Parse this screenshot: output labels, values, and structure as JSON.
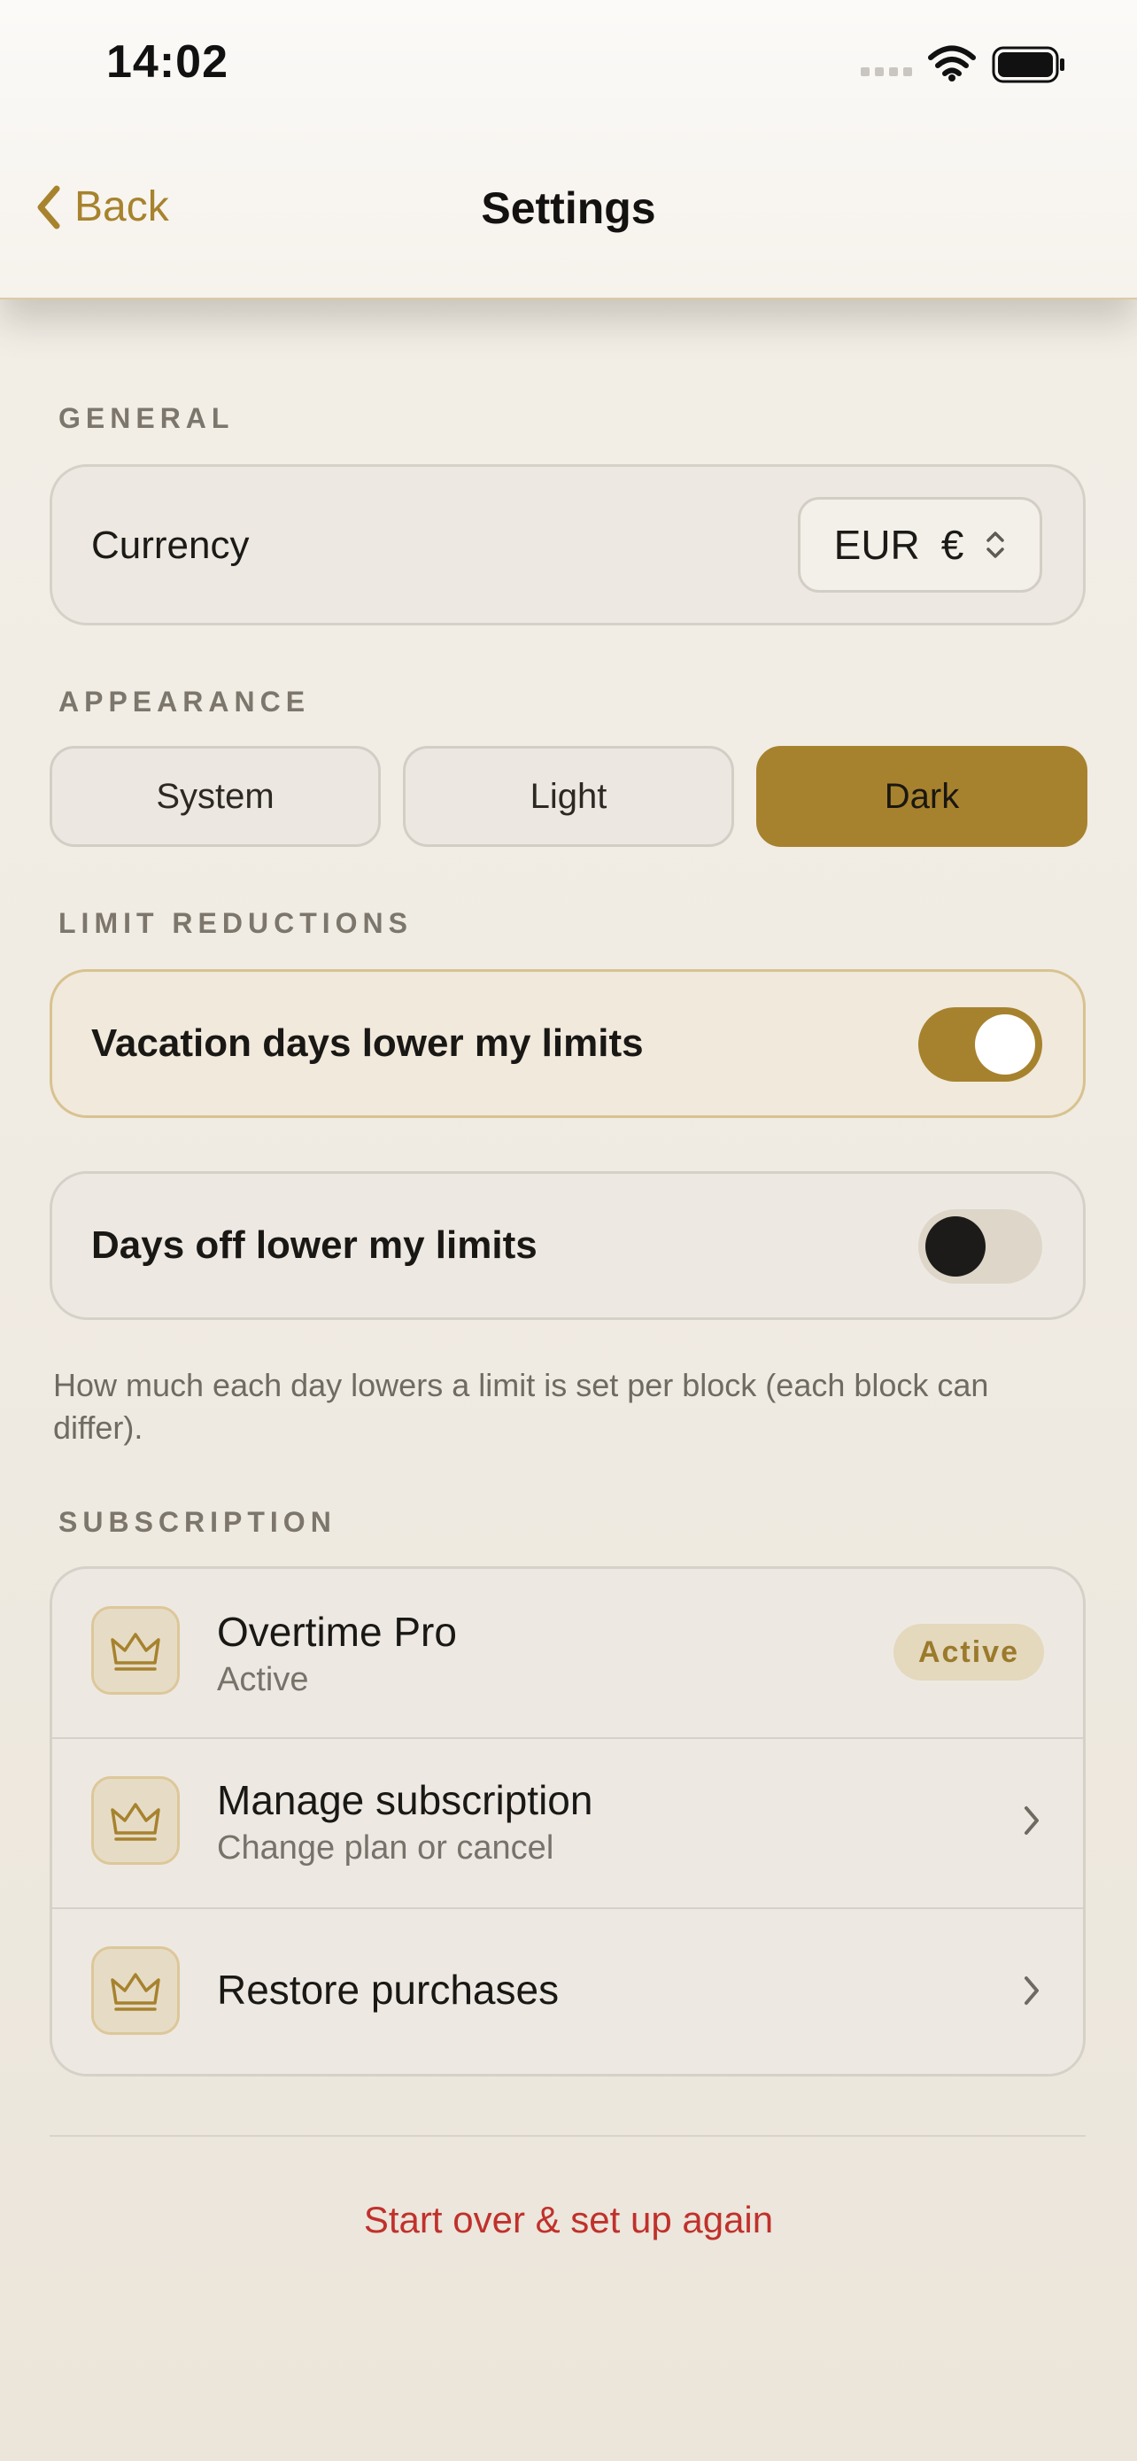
{
  "status_bar": {
    "time": "14:02"
  },
  "nav": {
    "back_label": "Back",
    "title": "Settings"
  },
  "sections": {
    "general": "GENERAL",
    "appearance": "APPEARANCE",
    "limit_reductions": "LIMIT REDUCTIONS",
    "subscription": "SUBSCRIPTION"
  },
  "general": {
    "currency_label": "Currency",
    "currency_code": "EUR",
    "currency_symbol": "€"
  },
  "appearance": {
    "options": [
      "System",
      "Light",
      "Dark"
    ],
    "selected": "Dark"
  },
  "limits": {
    "vacation_label": "Vacation days lower my limits",
    "vacation_on": true,
    "daysoff_label": "Days off lower my limits",
    "daysoff_on": false,
    "hint": "How much each day lowers a limit is set per block (each block can differ)."
  },
  "subscription": {
    "plan_title": "Overtime Pro",
    "plan_status": "Active",
    "plan_badge": "Active",
    "manage_title": "Manage subscription",
    "manage_sub": "Change plan or cancel",
    "restore_title": "Restore purchases"
  },
  "footer": {
    "reset_label": "Start over & set up again"
  },
  "colors": {
    "accent": "#a7822e",
    "destructive": "#c0312c",
    "background": "#efeae1"
  },
  "icons": [
    "chevron-left-icon",
    "chevron-up-down-icon",
    "crown-icon",
    "chevron-right-icon",
    "wifi-icon",
    "battery-icon",
    "signal-icon"
  ]
}
